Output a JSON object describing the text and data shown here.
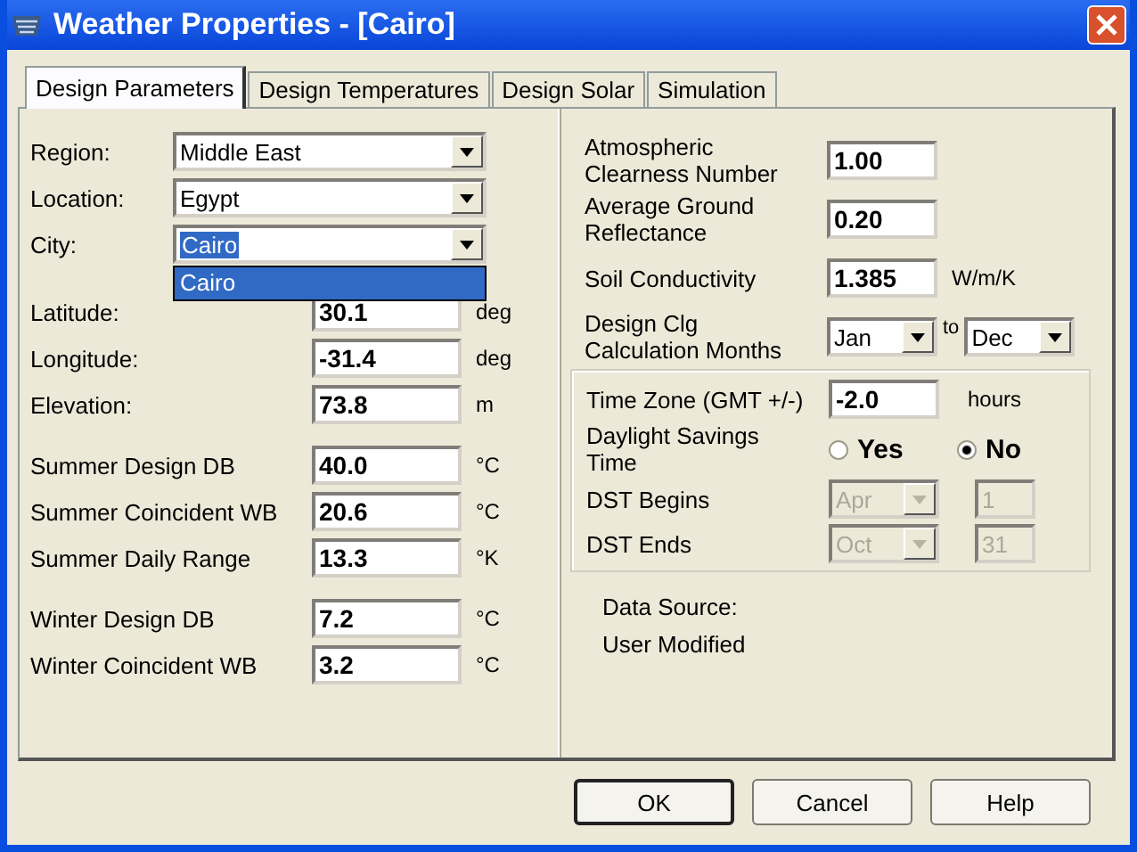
{
  "window": {
    "title": "Weather Properties - [Cairo]"
  },
  "tabs": [
    {
      "label": "Design Parameters",
      "selected": true
    },
    {
      "label": "Design Temperatures",
      "selected": false
    },
    {
      "label": "Design Solar",
      "selected": false
    },
    {
      "label": "Simulation",
      "selected": false
    }
  ],
  "location_combos": [
    {
      "label": "Region:",
      "value": "Middle East",
      "highlighted": false
    },
    {
      "label": "Location:",
      "value": "Egypt",
      "highlighted": false
    },
    {
      "label": "City:",
      "value": "Cairo",
      "highlighted": true
    }
  ],
  "city_list": [
    {
      "label": "Cairo",
      "selected": true
    }
  ],
  "left_groups": [
    [
      {
        "label": "Latitude:",
        "value": "30.1",
        "unit": "deg"
      },
      {
        "label": "Longitude:",
        "value": "-31.4",
        "unit": "deg"
      },
      {
        "label": "Elevation:",
        "value": "73.8",
        "unit": "m"
      }
    ],
    [
      {
        "label": "Summer Design DB",
        "value": "40.0",
        "unit": "°C"
      },
      {
        "label": "Summer Coincident WB",
        "value": "20.6",
        "unit": "°C"
      },
      {
        "label": "Summer Daily Range",
        "value": "13.3",
        "unit": "°K"
      }
    ],
    [
      {
        "label": "Winter Design DB",
        "value": "7.2",
        "unit": "°C"
      },
      {
        "label": "Winter Coincident WB",
        "value": "3.2",
        "unit": "°C"
      }
    ]
  ],
  "right_fields": [
    {
      "label": "Atmospheric Clearness Number",
      "value": "1.00"
    },
    {
      "label": "Average Ground Reflectance",
      "value": "0.20"
    },
    {
      "label": "Soil Conductivity",
      "value": "1.385",
      "unit": "W/m/K"
    }
  ],
  "calc_months": {
    "label": "Design Clg Calculation Months",
    "from": "Jan",
    "to_label": "to",
    "to": "Dec"
  },
  "time_zone": {
    "label": "Time Zone (GMT +/-)",
    "value": "-2.0",
    "unit": "hours"
  },
  "daylight_savings": {
    "label": "Daylight Savings Time",
    "options": [
      {
        "label": "Yes",
        "selected": false
      },
      {
        "label": "No",
        "selected": true
      }
    ]
  },
  "dst": [
    {
      "label": "DST Begins",
      "month": "Apr",
      "day": "1",
      "disabled": true
    },
    {
      "label": "DST Ends",
      "month": "Oct",
      "day": "31",
      "disabled": true
    }
  ],
  "data_source": {
    "label": "Data Source:",
    "value": "User Modified"
  },
  "buttons": [
    {
      "label": "OK",
      "default": true
    },
    {
      "label": "Cancel",
      "default": false
    },
    {
      "label": "Help",
      "default": false
    }
  ]
}
